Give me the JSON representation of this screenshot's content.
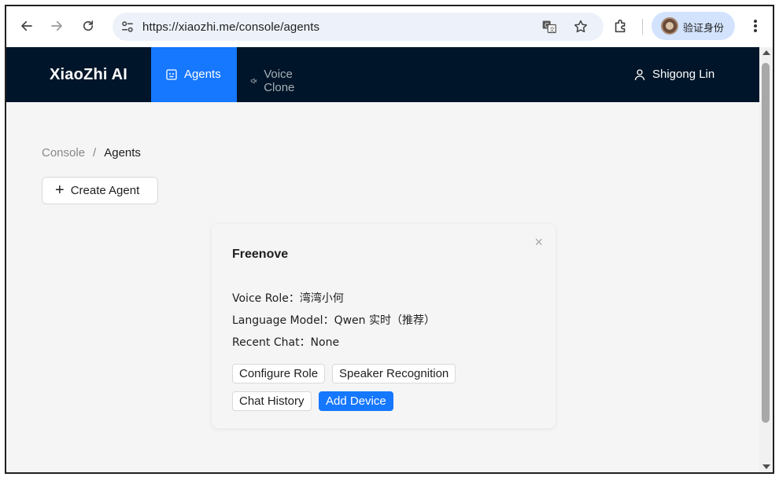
{
  "browser": {
    "url": "https://xiaozhi.me/console/agents",
    "profile_label": "验证身份",
    "icons": {
      "back": "arrow-left-icon",
      "forward": "arrow-right-icon",
      "reload": "reload-icon",
      "site_info": "tune-icon",
      "translate": "translate-icon",
      "bookmark": "star-icon",
      "extensions": "puzzle-icon",
      "menu": "kebab-menu-icon"
    }
  },
  "header": {
    "brand": "XiaoZhi AI",
    "nav": [
      {
        "label": "Agents",
        "icon": "robot-icon",
        "active": true
      },
      {
        "label": "Voice Clone",
        "icon": "sound-icon",
        "active": false
      }
    ],
    "user_name": "Shigong Lin"
  },
  "breadcrumb": {
    "root": "Console",
    "separator": "/",
    "current": "Agents"
  },
  "toolbar": {
    "create_label": "Create Agent"
  },
  "agent_card": {
    "name": "Freenove",
    "close": "×",
    "voice_role": "Voice Role：湾湾小何",
    "language_model": "Language Model：Qwen 实时（推荐）",
    "recent_chat": "Recent Chat：None",
    "buttons": {
      "configure": "Configure Role",
      "speaker": "Speaker Recognition",
      "history": "Chat History",
      "add_device": "Add Device"
    }
  },
  "colors": {
    "header_bg": "#001529",
    "accent": "#1677ff",
    "content_bg": "#f5f5f5"
  }
}
